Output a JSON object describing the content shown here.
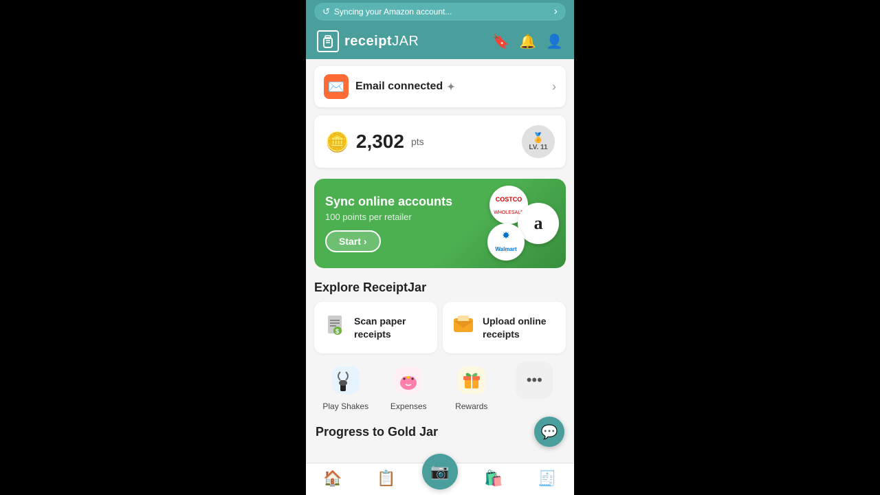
{
  "app": {
    "name": "receiptJAR",
    "logo_icon": "🫙"
  },
  "sync_banner": {
    "text": "Syncing your Amazon account...",
    "chevron": "›"
  },
  "header": {
    "bookmark_icon": "🔖",
    "bell_icon": "🔔",
    "user_icon": "👤"
  },
  "email_card": {
    "label": "Email connected",
    "sparkle": "✦",
    "icon": "✉️"
  },
  "points_card": {
    "coins_emoji": "🪙",
    "points_value": "2,302",
    "points_suffix": "pts",
    "level": "LV. 11"
  },
  "sync_accounts": {
    "title": "Sync online accounts",
    "subtitle": "100 points per retailer",
    "start_label": "Start",
    "retailers": [
      "Costco",
      "a",
      "Walmart"
    ]
  },
  "explore": {
    "title": "Explore ReceiptJar",
    "cards": [
      {
        "label": "Scan paper receipts",
        "icon": "🧾"
      },
      {
        "label": "Upload online receipts",
        "icon": "📧"
      }
    ],
    "quick_actions": [
      {
        "label": "Play Shakes",
        "icon": "🤲"
      },
      {
        "label": "Expenses",
        "icon": "🐷"
      },
      {
        "label": "Rewards",
        "icon": "🎁"
      },
      {
        "label": "•••",
        "icon": "···"
      }
    ]
  },
  "progress": {
    "title": "Progress to Gold Jar"
  },
  "bottom_nav": {
    "items": [
      {
        "label": "",
        "icon": "🏠",
        "active": true
      },
      {
        "label": "",
        "icon": "📋",
        "active": false
      },
      {
        "label": "",
        "icon": "📷",
        "active": false,
        "scan": true
      },
      {
        "label": "",
        "icon": "🛍️",
        "active": false
      },
      {
        "label": "",
        "icon": "🧾",
        "active": false
      }
    ]
  },
  "chat_fab": {
    "icon": "💬"
  },
  "help_btn": {
    "icon": "?"
  }
}
